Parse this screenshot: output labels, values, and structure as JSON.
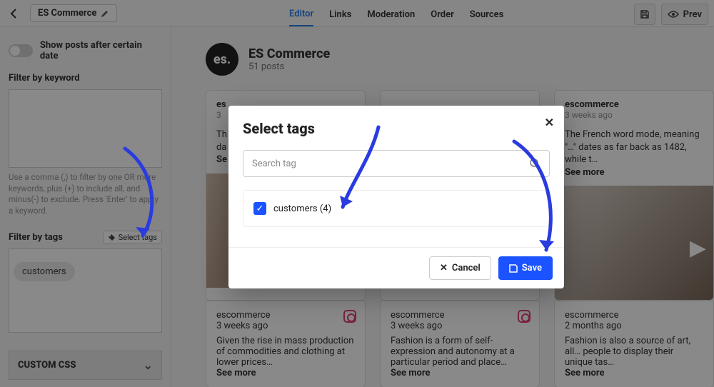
{
  "topbar": {
    "project_name": "ES Commerce",
    "nav": [
      "Editor",
      "Links",
      "Moderation",
      "Order",
      "Sources"
    ],
    "active_nav": 0,
    "preview_label": "Prev"
  },
  "sidebar": {
    "show_posts_label": "Show posts after certain date",
    "filter_keyword_label": "Filter by keyword",
    "keyword_hint": "Use a comma (,) to filter by one OR more keywords, plus (+) to include all, and minus(-) to exclude. Press 'Enter' to apply a keyword.",
    "filter_tags_label": "Filter by tags",
    "select_tags_btn": "Select tags",
    "applied_tag": "customers",
    "custom_css_label": "CUSTOM CSS"
  },
  "brand": {
    "logo_text": "es.",
    "name": "ES Commerce",
    "subtitle": "51 posts"
  },
  "cards": {
    "r1": [
      {
        "user": "es",
        "time": "3",
        "body": "Th",
        "body2": "da",
        "see": "Se"
      },
      {
        "user": "",
        "time": "",
        "body": "",
        "see": ""
      },
      {
        "user": "escommerce",
        "time": "3 weeks ago",
        "body": "The French word mode, meaning \"…\" dates as far back as 1482, while t…",
        "see": "See more"
      }
    ],
    "r2": [
      {
        "user": "escommerce",
        "time": "3 weeks ago",
        "body": "Given the rise in mass production of commodities and clothing at lower prices…",
        "see": "See more"
      },
      {
        "user": "escommerce",
        "time": "3 weeks ago",
        "body": "Fashion is a form of self-expression and autonomy at a particular period and place…",
        "see": "See more"
      },
      {
        "user": "escommerce",
        "time": "2 months ago",
        "body": "Fashion is also a source of art, all… people to display their unique tas…",
        "see": "See more"
      }
    ]
  },
  "modal": {
    "title": "Select tags",
    "search_placeholder": "Search tag",
    "option_label": "customers (4)",
    "cancel": "Cancel",
    "save": "Save"
  }
}
